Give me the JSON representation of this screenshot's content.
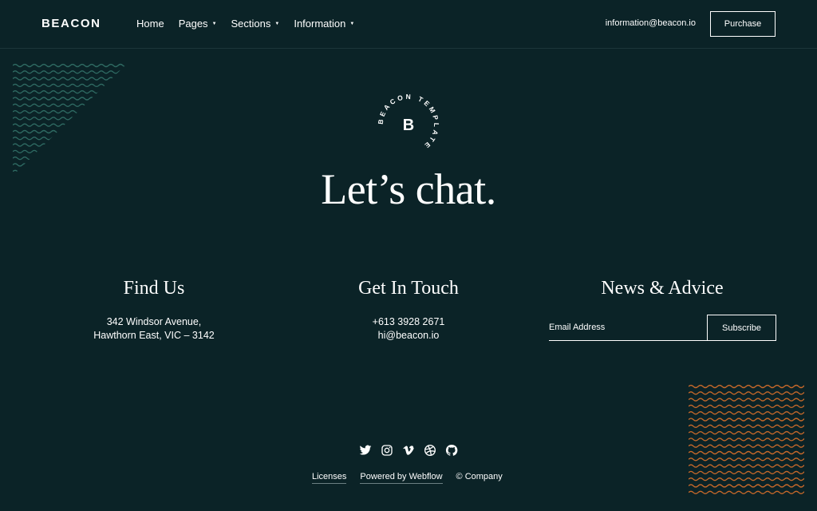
{
  "header": {
    "logo": "BEACON",
    "nav": [
      {
        "label": "Home",
        "has_caret": false
      },
      {
        "label": "Pages",
        "has_caret": true
      },
      {
        "label": "Sections",
        "has_caret": true
      },
      {
        "label": "Information",
        "has_caret": true
      }
    ],
    "email": "information@beacon.io",
    "purchase_label": "Purchase"
  },
  "badge": {
    "letter": "B",
    "ring_text": "BEACON TEMPLATE"
  },
  "headline": "Let’s chat.",
  "find_us": {
    "title": "Find Us",
    "line1": "342 Windsor Avenue,",
    "line2": "Hawthorn East, VIC – 3142"
  },
  "get_in_touch": {
    "title": "Get In Touch",
    "phone": "+613 3928 2671",
    "email": "hi@beacon.io"
  },
  "news": {
    "title": "News & Advice",
    "email_placeholder": "Email Address",
    "subscribe_label": "Subscribe"
  },
  "social_icons": [
    "twitter-icon",
    "instagram-icon",
    "vimeo-icon",
    "dribbble-icon",
    "github-icon"
  ],
  "footer": {
    "licenses": "Licenses",
    "powered": "Powered by Webflow",
    "copyright": "© Company"
  },
  "colors": {
    "background": "#0b2327",
    "wave_green": "#2f6b63",
    "wave_orange": "#c8692a"
  }
}
